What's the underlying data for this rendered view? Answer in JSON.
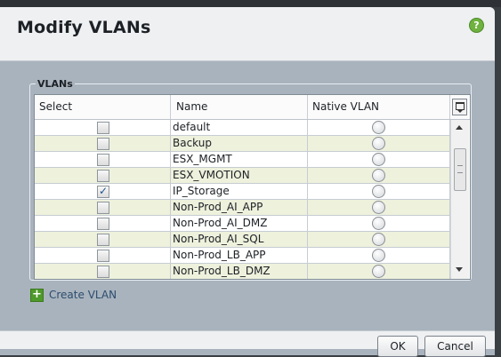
{
  "dialog": {
    "title": "Modify VLANs",
    "help_icon": "question-icon",
    "help_glyph": "?"
  },
  "vlans_group": {
    "legend": "VLANs",
    "columns": {
      "select": "Select",
      "name": "Name",
      "native_vlan": "Native VLAN"
    },
    "rows": [
      {
        "name": "default",
        "selected": false,
        "native": false
      },
      {
        "name": "Backup",
        "selected": false,
        "native": false
      },
      {
        "name": "ESX_MGMT",
        "selected": false,
        "native": false
      },
      {
        "name": "ESX_VMOTION",
        "selected": false,
        "native": false
      },
      {
        "name": "IP_Storage",
        "selected": true,
        "native": false
      },
      {
        "name": "Non-Prod_AI_APP",
        "selected": false,
        "native": false
      },
      {
        "name": "Non-Prod_AI_DMZ",
        "selected": false,
        "native": false
      },
      {
        "name": "Non-Prod_AI_SQL",
        "selected": false,
        "native": false
      },
      {
        "name": "Non-Prod_LB_APP",
        "selected": false,
        "native": false
      },
      {
        "name": "Non-Prod_LB_DMZ",
        "selected": false,
        "native": false
      }
    ]
  },
  "actions": {
    "create_vlan": "Create VLAN",
    "ok": "OK",
    "cancel": "Cancel"
  },
  "colors": {
    "dialog_bg": "#a9b3bd",
    "row_alt": "#eef1dc",
    "accent_green": "#4e9a2a"
  }
}
